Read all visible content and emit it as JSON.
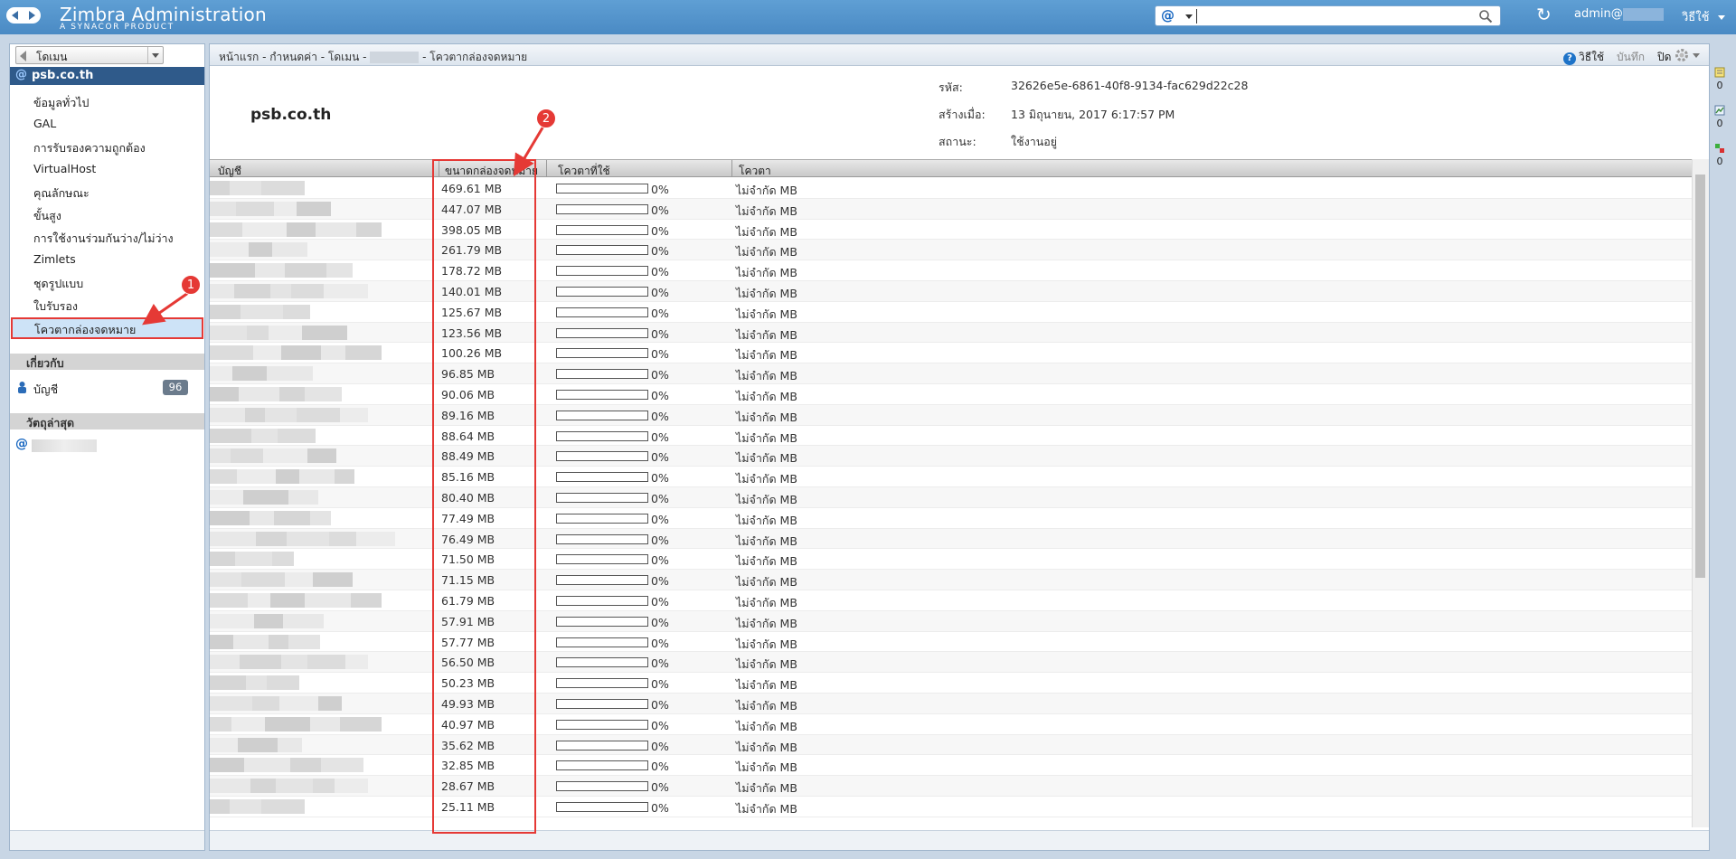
{
  "app": {
    "title": "Zimbra Administration",
    "subtitle": "A SYNACOR PRODUCT",
    "user": "admin@",
    "help_menu": "วิธีใช้"
  },
  "search": {
    "value": "",
    "placeholder": "",
    "type_symbol": "@"
  },
  "sidebar": {
    "selector_label": "โดเมน",
    "domain": "psb.co.th",
    "items": [
      {
        "label": "ข้อมูลทั่วไป"
      },
      {
        "label": "GAL"
      },
      {
        "label": "การรับรองความถูกต้อง"
      },
      {
        "label": "VirtualHost"
      },
      {
        "label": "คุณลักษณะ"
      },
      {
        "label": "ขั้นสูง"
      },
      {
        "label": "การใช้งานร่วมกันว่าง/ไม่ว่าง"
      },
      {
        "label": "Zimlets"
      },
      {
        "label": "ชุดรูปแบบ"
      },
      {
        "label": "ใบรับรอง"
      },
      {
        "label": "โควตากล่องจดหมาย"
      }
    ],
    "related_header": "เกี่ยวกับ",
    "accounts_label": "บัญชี",
    "accounts_count": "96",
    "recent_header": "วัตถุล่าสุด"
  },
  "main": {
    "breadcrumb_left": "หน้าแรก - กำหนดค่า - โดเมน -",
    "breadcrumb_right": "- โควตากล่องจดหมาย",
    "help": "วิธีใช้",
    "save": "บันทึก",
    "close": "ปิด",
    "domain_name": "psb.co.th",
    "info": {
      "id_label": "รหัส:",
      "id_value": "32626e5e-6861-40f8-9134-fac629d22c28",
      "created_label": "สร้างเมื่อ:",
      "created_value": "13 มิถุนายน, 2017 6:17:57 PM",
      "status_label": "สถานะ:",
      "status_value": "ใช้งานอยู่"
    },
    "table": {
      "columns": [
        "บัญชี",
        "ขนาดกล่องจดหมาย",
        "โควตาที่ใช้",
        "โควตา"
      ],
      "rows": [
        {
          "size": "469.61 MB",
          "pct": "0%",
          "quota": "ไม่จำกัด MB"
        },
        {
          "size": "447.07 MB",
          "pct": "0%",
          "quota": "ไม่จำกัด MB"
        },
        {
          "size": "398.05 MB",
          "pct": "0%",
          "quota": "ไม่จำกัด MB"
        },
        {
          "size": "261.79 MB",
          "pct": "0%",
          "quota": "ไม่จำกัด MB"
        },
        {
          "size": "178.72 MB",
          "pct": "0%",
          "quota": "ไม่จำกัด MB"
        },
        {
          "size": "140.01 MB",
          "pct": "0%",
          "quota": "ไม่จำกัด MB"
        },
        {
          "size": "125.67 MB",
          "pct": "0%",
          "quota": "ไม่จำกัด MB"
        },
        {
          "size": "123.56 MB",
          "pct": "0%",
          "quota": "ไม่จำกัด MB"
        },
        {
          "size": "100.26 MB",
          "pct": "0%",
          "quota": "ไม่จำกัด MB"
        },
        {
          "size": "96.85 MB",
          "pct": "0%",
          "quota": "ไม่จำกัด MB"
        },
        {
          "size": "90.06 MB",
          "pct": "0%",
          "quota": "ไม่จำกัด MB"
        },
        {
          "size": "89.16 MB",
          "pct": "0%",
          "quota": "ไม่จำกัด MB"
        },
        {
          "size": "88.64 MB",
          "pct": "0%",
          "quota": "ไม่จำกัด MB"
        },
        {
          "size": "88.49 MB",
          "pct": "0%",
          "quota": "ไม่จำกัด MB"
        },
        {
          "size": "85.16 MB",
          "pct": "0%",
          "quota": "ไม่จำกัด MB"
        },
        {
          "size": "80.40 MB",
          "pct": "0%",
          "quota": "ไม่จำกัด MB"
        },
        {
          "size": "77.49 MB",
          "pct": "0%",
          "quota": "ไม่จำกัด MB"
        },
        {
          "size": "76.49 MB",
          "pct": "0%",
          "quota": "ไม่จำกัด MB"
        },
        {
          "size": "71.50 MB",
          "pct": "0%",
          "quota": "ไม่จำกัด MB"
        },
        {
          "size": "71.15 MB",
          "pct": "0%",
          "quota": "ไม่จำกัด MB"
        },
        {
          "size": "61.79 MB",
          "pct": "0%",
          "quota": "ไม่จำกัด MB"
        },
        {
          "size": "57.91 MB",
          "pct": "0%",
          "quota": "ไม่จำกัด MB"
        },
        {
          "size": "57.77 MB",
          "pct": "0%",
          "quota": "ไม่จำกัด MB"
        },
        {
          "size": "56.50 MB",
          "pct": "0%",
          "quota": "ไม่จำกัด MB"
        },
        {
          "size": "50.23 MB",
          "pct": "0%",
          "quota": "ไม่จำกัด MB"
        },
        {
          "size": "49.93 MB",
          "pct": "0%",
          "quota": "ไม่จำกัด MB"
        },
        {
          "size": "40.97 MB",
          "pct": "0%",
          "quota": "ไม่จำกัด MB"
        },
        {
          "size": "35.62 MB",
          "pct": "0%",
          "quota": "ไม่จำกัด MB"
        },
        {
          "size": "32.85 MB",
          "pct": "0%",
          "quota": "ไม่จำกัด MB"
        },
        {
          "size": "28.67 MB",
          "pct": "0%",
          "quota": "ไม่จำกัด MB"
        },
        {
          "size": "25.11 MB",
          "pct": "0%",
          "quota": "ไม่จำกัด MB"
        }
      ]
    }
  },
  "annotations": {
    "callout_1": "1",
    "callout_2": "2"
  },
  "right_rail": [
    {
      "icon": "notepad-icon",
      "count": "0"
    },
    {
      "icon": "chart-icon",
      "count": "0"
    },
    {
      "icon": "status-flags-icon",
      "count": "0"
    }
  ],
  "colors": {
    "topbar": "#4a8ac4",
    "selection": "#cde3f7",
    "domain_header": "#2f5a8a",
    "highlight": "#e53935"
  }
}
